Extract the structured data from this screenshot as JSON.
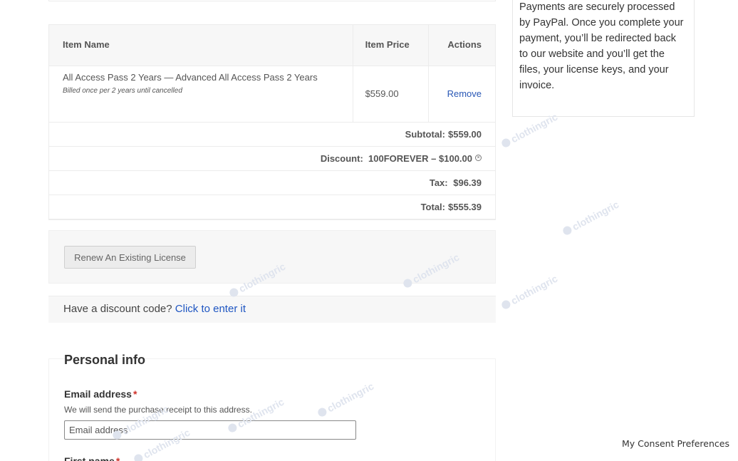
{
  "cart": {
    "headers": {
      "item_name": "Item Name",
      "item_price": "Item Price",
      "actions": "Actions"
    },
    "items": [
      {
        "name": "All Access Pass 2 Years — Advanced All Access Pass 2 Years",
        "billing": "Billed once per 2 years until cancelled",
        "price": "$559.00",
        "action": "Remove"
      }
    ],
    "subtotal_label": "Subtotal:",
    "subtotal_value": "$559.00",
    "discount_label": "Discount:",
    "discount_value": "100FOREVER – $100.00",
    "tax_label": "Tax:",
    "tax_value": "$96.39",
    "total_label": "Total:",
    "total_value": "$555.39"
  },
  "renew": {
    "button_label": "Renew An Existing License"
  },
  "discount": {
    "prompt": "Have a discount code?",
    "link": "Click to enter it"
  },
  "personal": {
    "title": "Personal info",
    "email_label": "Email address",
    "required_mark": "*",
    "email_hint": "We will send the purchase receipt to this address.",
    "email_placeholder": "Email address",
    "first_name_label": "First name"
  },
  "sidebar": {
    "text": "Payments are securely processed by PayPal. Once you complete your payment, you’ll be redirected back to our website and you’ll get the files, your license keys, and your invoice."
  },
  "consent": {
    "label": "My Consent Preferences"
  },
  "watermark": {
    "text": "clothingric",
    "color": "#dfe4ee"
  },
  "colors": {
    "link": "#1f56c2",
    "required": "#d0332b"
  }
}
